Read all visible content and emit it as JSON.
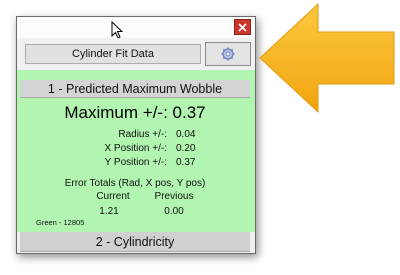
{
  "window": {
    "title_field": "Cylinder Fit Data",
    "close_icon": "close-icon",
    "settings_icon": "gear-icon",
    "cursor_icon": "cursor-arrow-icon"
  },
  "section1": {
    "header": "1 - Predicted Maximum Wobble",
    "maximum": "Maximum +/-: 0.37",
    "rows": [
      {
        "label": "Radius +/-:",
        "value": "0.04"
      },
      {
        "label": "X Position +/-:",
        "value": "0.20"
      },
      {
        "label": "Y Position +/-:",
        "value": "0.37"
      }
    ],
    "totals_title": "Error Totals (Rad, X pos, Y pos)",
    "current_label": "Current",
    "previous_label": "Previous",
    "current_value": "1.21",
    "previous_value": "0.00",
    "footer_note": "Green - 12805"
  },
  "section2": {
    "header": "2 - Cylindricity"
  },
  "colors": {
    "panel_green": "#b2f5b0",
    "close_red": "#c9362b",
    "arrow_yellow": "#f7b21c"
  }
}
